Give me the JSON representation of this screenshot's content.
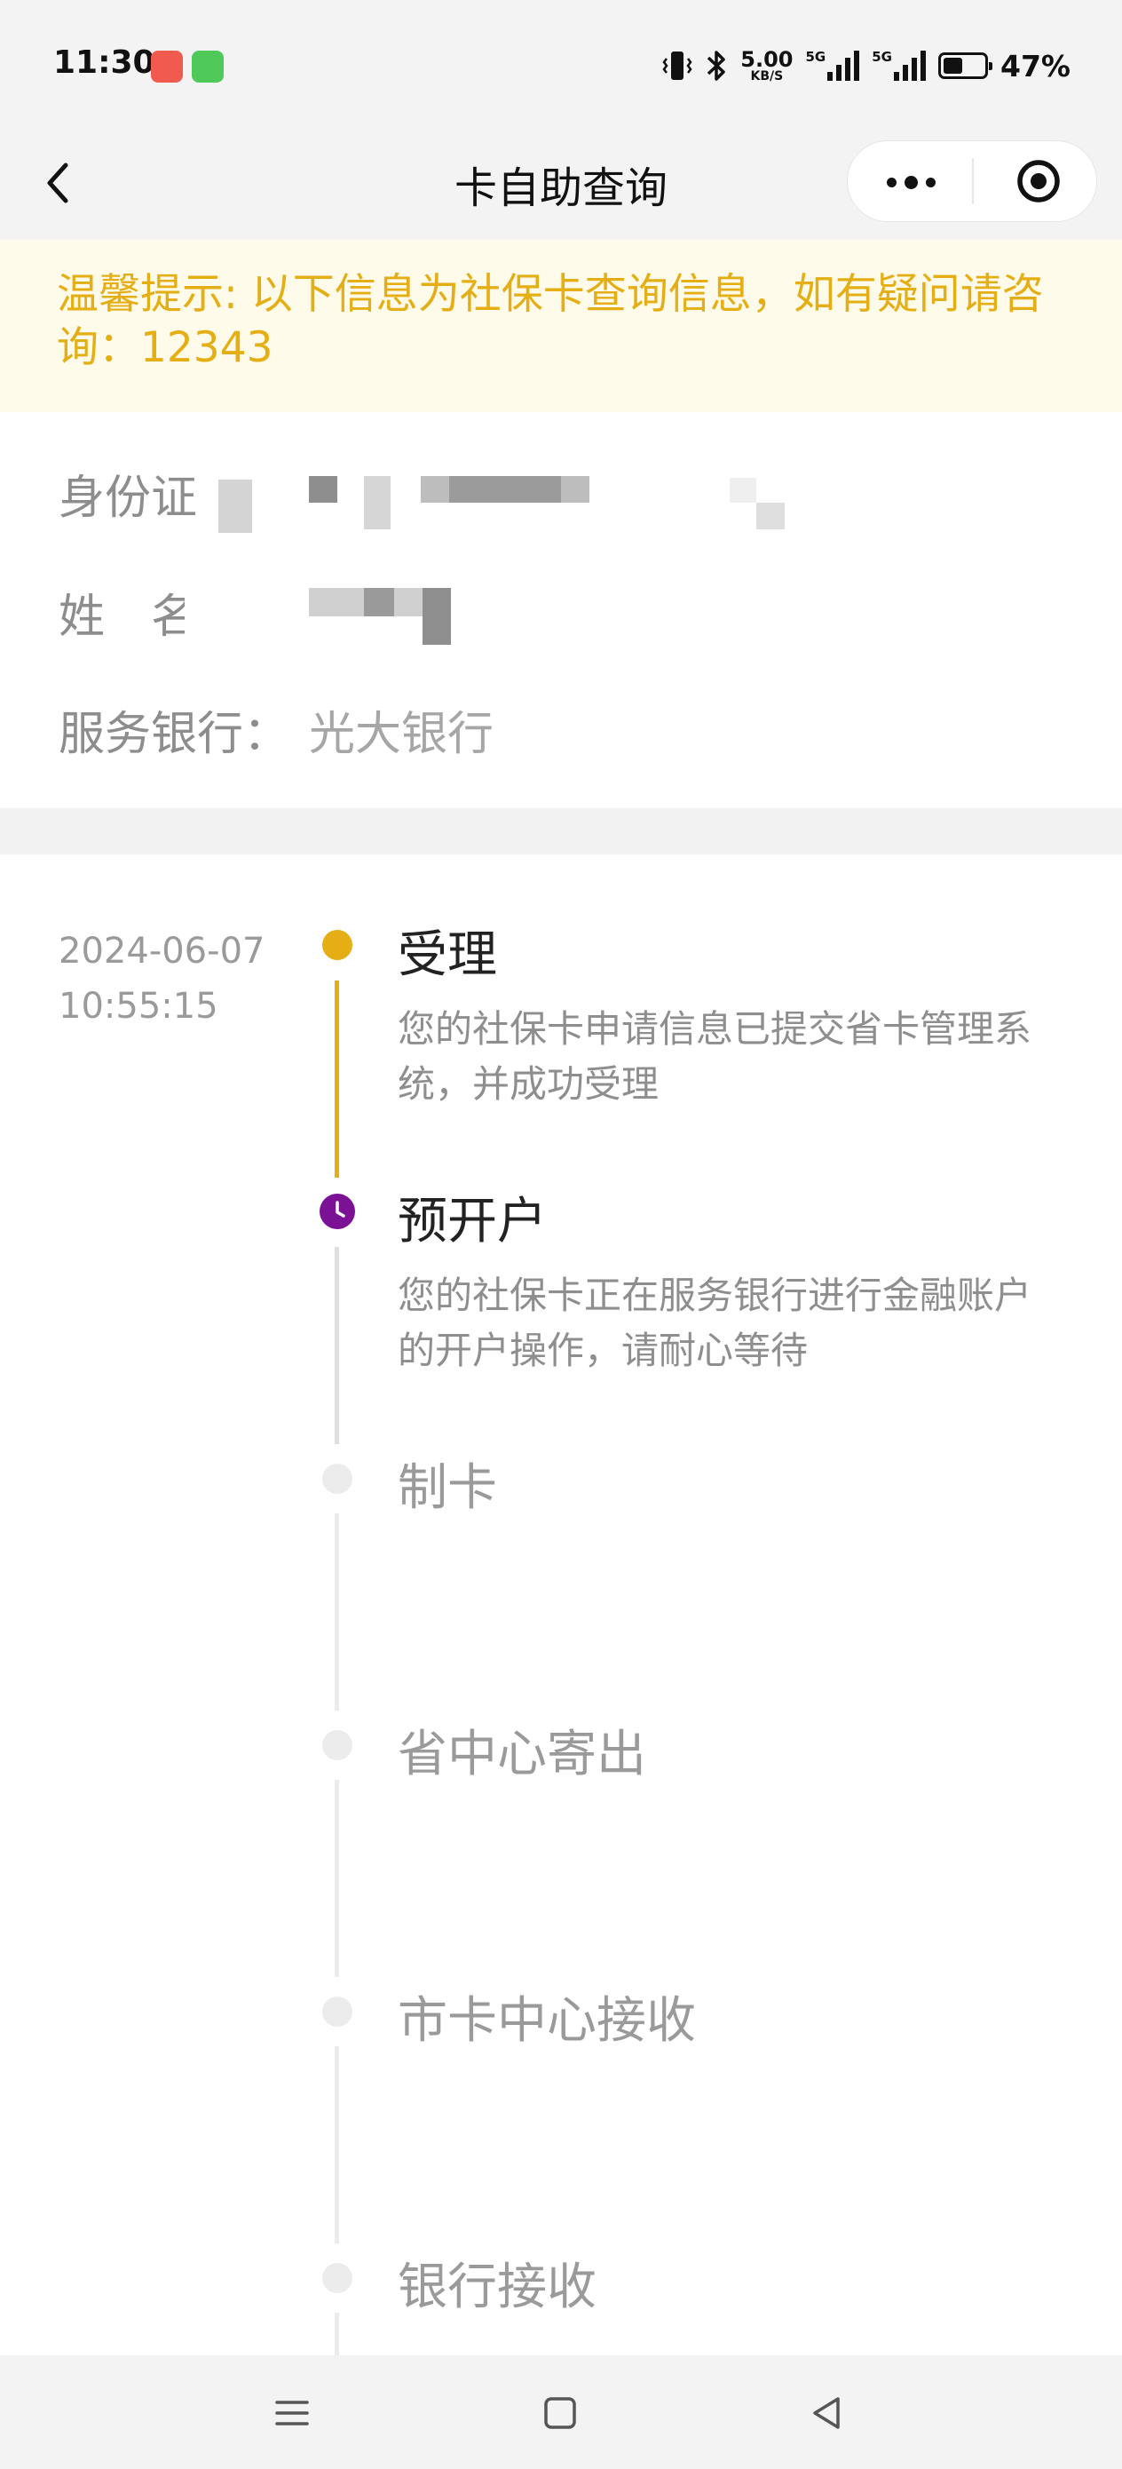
{
  "status_bar": {
    "time": "11:30",
    "network_speed": "5.00",
    "network_speed_unit": "KB/S",
    "signal_label_1": "5G",
    "signal_label_2": "5G",
    "battery_percent": "47%",
    "battery_level": 0.47
  },
  "nav": {
    "title": "卡自助查询"
  },
  "notice": {
    "text": "温馨提示: 以下信息为社保卡查询信息，如有疑问请咨询：12343"
  },
  "info": {
    "id_label": "身份证号",
    "name_label": "姓　名",
    "bank_label": "服务银行：",
    "bank_value": "光大银行"
  },
  "timeline": {
    "timestamp_date": "2024-06-07",
    "timestamp_time": "10:55:15",
    "steps": [
      {
        "title": "受理",
        "desc": "您的社保卡申请信息已提交省卡管理系统，并成功受理",
        "status": "done"
      },
      {
        "title": "预开户",
        "desc": "您的社保卡正在服务银行进行金融账户的开户操作，请耐心等待",
        "status": "current"
      },
      {
        "title": "制卡",
        "desc": "",
        "status": "pending"
      },
      {
        "title": "省中心寄出",
        "desc": "",
        "status": "pending"
      },
      {
        "title": "市卡中心接收",
        "desc": "",
        "status": "pending"
      },
      {
        "title": "银行接收",
        "desc": "",
        "status": "pending"
      }
    ]
  },
  "colors": {
    "accent_yellow": "#e4ae14",
    "current_purple": "#7b1296",
    "pending_grey": "#ececec",
    "notice_bg": "#fefbea"
  }
}
